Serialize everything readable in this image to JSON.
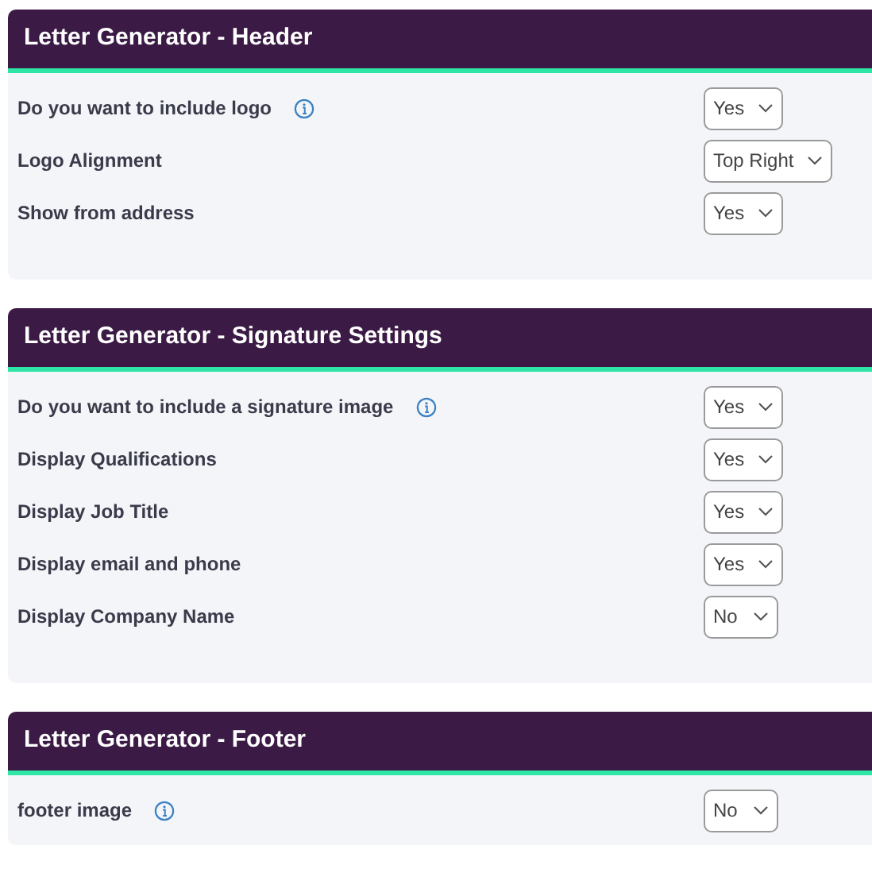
{
  "panels": [
    {
      "title": "Letter Generator - Header",
      "rows": [
        {
          "label": "Do you want to include logo",
          "info": true,
          "value": "Yes"
        },
        {
          "label": "Logo Alignment",
          "info": false,
          "value": "Top Right"
        },
        {
          "label": "Show from address",
          "info": false,
          "value": "Yes"
        }
      ]
    },
    {
      "title": "Letter Generator - Signature Settings",
      "rows": [
        {
          "label": "Do you want to include a signature image",
          "info": true,
          "value": "Yes"
        },
        {
          "label": "Display Qualifications",
          "info": false,
          "value": "Yes"
        },
        {
          "label": "Display Job Title",
          "info": false,
          "value": "Yes"
        },
        {
          "label": "Display email and phone",
          "info": false,
          "value": "Yes"
        },
        {
          "label": "Display Company Name",
          "info": false,
          "value": "No"
        }
      ]
    },
    {
      "title": "Letter Generator - Footer",
      "rows": [
        {
          "label": "footer image",
          "info": true,
          "value": "No"
        }
      ]
    }
  ]
}
